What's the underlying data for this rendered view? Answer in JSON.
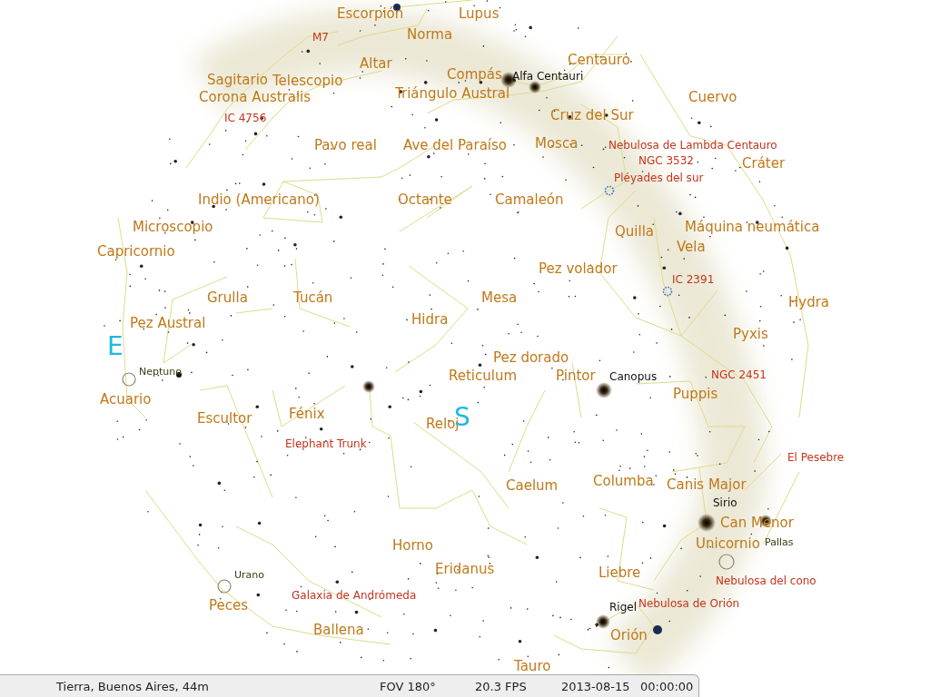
{
  "sky_labels": [
    {
      "kind": "constellation",
      "text": "Escorpión"
    },
    {
      "kind": "constellation",
      "text": "Lupus"
    },
    {
      "kind": "deep_sky",
      "text": "M7"
    },
    {
      "kind": "constellation",
      "text": "Norma"
    },
    {
      "kind": "constellation",
      "text": "Altar"
    },
    {
      "kind": "constellation",
      "text": "Centauro"
    },
    {
      "kind": "constellation",
      "text": "Sagitario"
    },
    {
      "kind": "constellation",
      "text": "Telescopio"
    },
    {
      "kind": "constellation",
      "text": "Compás"
    },
    {
      "kind": "star",
      "text": "Alfa Centauri"
    },
    {
      "kind": "constellation",
      "text": "Corona Australis"
    },
    {
      "kind": "constellation",
      "text": "Triángulo Austral"
    },
    {
      "kind": "constellation",
      "text": "Cuervo"
    },
    {
      "kind": "deep_sky",
      "text": "IC 4756"
    },
    {
      "kind": "constellation",
      "text": "Cruz del Sur"
    },
    {
      "kind": "constellation",
      "text": "Pavo real"
    },
    {
      "kind": "constellation",
      "text": "Ave del Paraíso"
    },
    {
      "kind": "constellation",
      "text": "Mosca"
    },
    {
      "kind": "deep_sky",
      "text": "Nebulosa de Lambda Centauro"
    },
    {
      "kind": "deep_sky",
      "text": "NGC 3532"
    },
    {
      "kind": "constellation",
      "text": "Cráter"
    },
    {
      "kind": "deep_sky",
      "text": "Pléyades del sur"
    },
    {
      "kind": "constellation",
      "text": "Indio (Americano)"
    },
    {
      "kind": "constellation",
      "text": "Octante"
    },
    {
      "kind": "constellation",
      "text": "Camaleón"
    },
    {
      "kind": "constellation",
      "text": "Microscopio"
    },
    {
      "kind": "constellation",
      "text": "Quilla"
    },
    {
      "kind": "constellation",
      "text": "Máquina neumática"
    },
    {
      "kind": "constellation",
      "text": "Capricornio"
    },
    {
      "kind": "constellation",
      "text": "Vela"
    },
    {
      "kind": "constellation",
      "text": "Pez volador"
    },
    {
      "kind": "deep_sky",
      "text": "IC 2391"
    },
    {
      "kind": "constellation",
      "text": "Grulla"
    },
    {
      "kind": "constellation",
      "text": "Tucán"
    },
    {
      "kind": "constellation",
      "text": "Mesa"
    },
    {
      "kind": "constellation",
      "text": "Hydra"
    },
    {
      "kind": "constellation",
      "text": "Pez Austral"
    },
    {
      "kind": "constellation",
      "text": "Hidra"
    },
    {
      "kind": "cardinal",
      "text": "E"
    },
    {
      "kind": "constellation",
      "text": "Pyxis"
    },
    {
      "kind": "constellation",
      "text": "Pez dorado"
    },
    {
      "kind": "planet",
      "text": "Neptuno"
    },
    {
      "kind": "constellation",
      "text": "Reticulum"
    },
    {
      "kind": "constellation",
      "text": "Pintor"
    },
    {
      "kind": "star",
      "text": "Canopus"
    },
    {
      "kind": "deep_sky",
      "text": "NGC 2451"
    },
    {
      "kind": "constellation",
      "text": "Acuario"
    },
    {
      "kind": "constellation",
      "text": "Puppis"
    },
    {
      "kind": "constellation",
      "text": "Escultor"
    },
    {
      "kind": "constellation",
      "text": "Fénix"
    },
    {
      "kind": "constellation",
      "text": "Reloj"
    },
    {
      "kind": "cardinal",
      "text": "S"
    },
    {
      "kind": "deep_sky",
      "text": "Elephant Trunk"
    },
    {
      "kind": "deep_sky",
      "text": "El Pesebre"
    },
    {
      "kind": "constellation",
      "text": "Caelum"
    },
    {
      "kind": "constellation",
      "text": "Columba"
    },
    {
      "kind": "constellation",
      "text": "Canis Major"
    },
    {
      "kind": "star",
      "text": "Sirio"
    },
    {
      "kind": "constellation",
      "text": "Can Menor"
    },
    {
      "kind": "constellation",
      "text": "Horno"
    },
    {
      "kind": "constellation",
      "text": "Unicornio"
    },
    {
      "kind": "planet",
      "text": "Pallas"
    },
    {
      "kind": "planet",
      "text": "Urano"
    },
    {
      "kind": "constellation",
      "text": "Eridanus"
    },
    {
      "kind": "constellation",
      "text": "Liebre"
    },
    {
      "kind": "deep_sky",
      "text": "Nebulosa del cono"
    },
    {
      "kind": "constellation",
      "text": "Peces"
    },
    {
      "kind": "deep_sky",
      "text": "Galaxia de Andrómeda"
    },
    {
      "kind": "star",
      "text": "Rigel"
    },
    {
      "kind": "deep_sky",
      "text": "Nebulosa de Orión"
    },
    {
      "kind": "constellation",
      "text": "Ballena"
    },
    {
      "kind": "constellation",
      "text": "Orión"
    },
    {
      "kind": "constellation",
      "text": "Tauro"
    }
  ],
  "status_bar": {
    "location": "Tierra, Buenos Aires, 44m",
    "fov": "FOV 180°",
    "fps": "20.3 FPS",
    "date": "2013-08-15",
    "time": "00:00:00"
  }
}
